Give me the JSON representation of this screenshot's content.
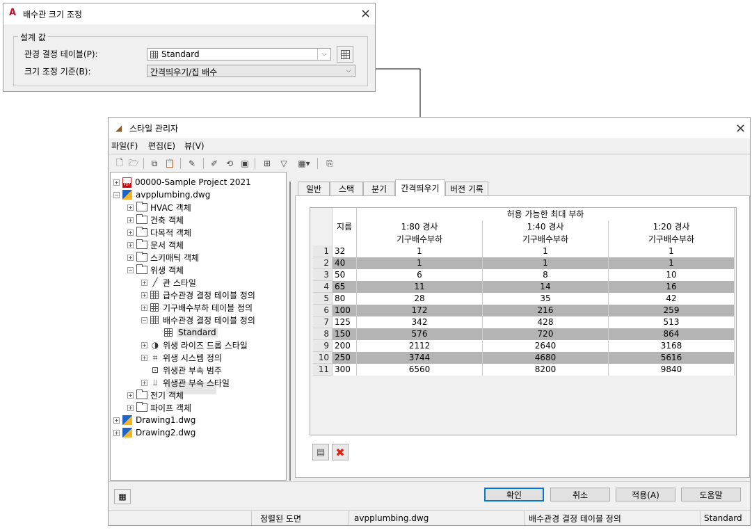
{
  "resize_dialog": {
    "title": "배수관 크기 조정",
    "group_label": "설계 값",
    "table_label": "관경 결정 테이블(P):",
    "table_value": "Standard",
    "basis_label": "크기 조정 기준(B):",
    "basis_value": "간격띄우기/집 배수"
  },
  "style_manager": {
    "title": "스타일 관리자",
    "menus": [
      "파일(F)",
      "편집(E)",
      "뷰(V)"
    ],
    "tree": [
      {
        "label": "00000-Sample Project 2021",
        "icon": "pdf-project-icon"
      },
      {
        "label": "avpplumbing.dwg",
        "icon": "dwg-icon"
      },
      {
        "label": "HVAC 객체",
        "icon": "folder-icon"
      },
      {
        "label": "건축 객체",
        "icon": "folder-icon"
      },
      {
        "label": "다목적 객체",
        "icon": "folder-icon"
      },
      {
        "label": "문서 객체",
        "icon": "folder-icon"
      },
      {
        "label": "스키매틱 객체",
        "icon": "folder-icon"
      },
      {
        "label": "위생 객체",
        "icon": "folder-icon"
      },
      {
        "label": "관 스타일",
        "icon": "pipe-style-icon"
      },
      {
        "label": "급수관경 결정 테이블 정의",
        "icon": "table-icon"
      },
      {
        "label": "기구배수부하 테이블 정의",
        "icon": "table-icon"
      },
      {
        "label": "배수관경 결정 테이블 정의",
        "icon": "table-icon"
      },
      {
        "label": "Standard",
        "icon": "table-icon"
      },
      {
        "label": "위생 라이즈 드롭 스타일",
        "icon": "rise-drop-icon"
      },
      {
        "label": "위생 시스템 정의",
        "icon": "system-icon"
      },
      {
        "label": "위생관 부속 범주",
        "icon": "category-icon"
      },
      {
        "label": "위생관 부속 스타일",
        "icon": "fitting-icon"
      },
      {
        "label": "전기 객체",
        "icon": "folder-icon"
      },
      {
        "label": "파이프 객체",
        "icon": "folder-icon"
      },
      {
        "label": "Drawing1.dwg",
        "icon": "dwg-icon"
      },
      {
        "label": "Drawing2.dwg",
        "icon": "dwg-icon"
      }
    ],
    "tabs": [
      "일반",
      "스택",
      "분기",
      "간격띄우기",
      "버전 기록"
    ],
    "active_tab": "간격띄우기",
    "grid": {
      "header_top": "허용 가능한 최대 부하",
      "col_size": "지름",
      "col1": [
        "1:80 경사",
        "기구배수부하"
      ],
      "col2": [
        "1:40 경사",
        "기구배수부하"
      ],
      "col3": [
        "1:20 경사",
        "기구배수부하"
      ],
      "rows": [
        [
          "1",
          "32",
          "1",
          "1",
          "1"
        ],
        [
          "2",
          "40",
          "1",
          "1",
          "1"
        ],
        [
          "3",
          "50",
          "6",
          "8",
          "10"
        ],
        [
          "4",
          "65",
          "11",
          "14",
          "16"
        ],
        [
          "5",
          "80",
          "28",
          "35",
          "42"
        ],
        [
          "6",
          "100",
          "172",
          "216",
          "259"
        ],
        [
          "7",
          "125",
          "342",
          "428",
          "513"
        ],
        [
          "8",
          "150",
          "576",
          "720",
          "864"
        ],
        [
          "9",
          "200",
          "2112",
          "2640",
          "3168"
        ],
        [
          "10",
          "250",
          "3744",
          "4680",
          "5616"
        ],
        [
          "11",
          "300",
          "6560",
          "8200",
          "9840"
        ]
      ]
    },
    "buttons": {
      "ok": "확인",
      "cancel": "취소",
      "apply": "적용(A)",
      "help": "도움말"
    },
    "status": {
      "filter": "정렬된 도면",
      "drawing": "avpplumbing.dwg",
      "category": "배수관경 결정 테이블 정의",
      "style": "Standard"
    }
  }
}
